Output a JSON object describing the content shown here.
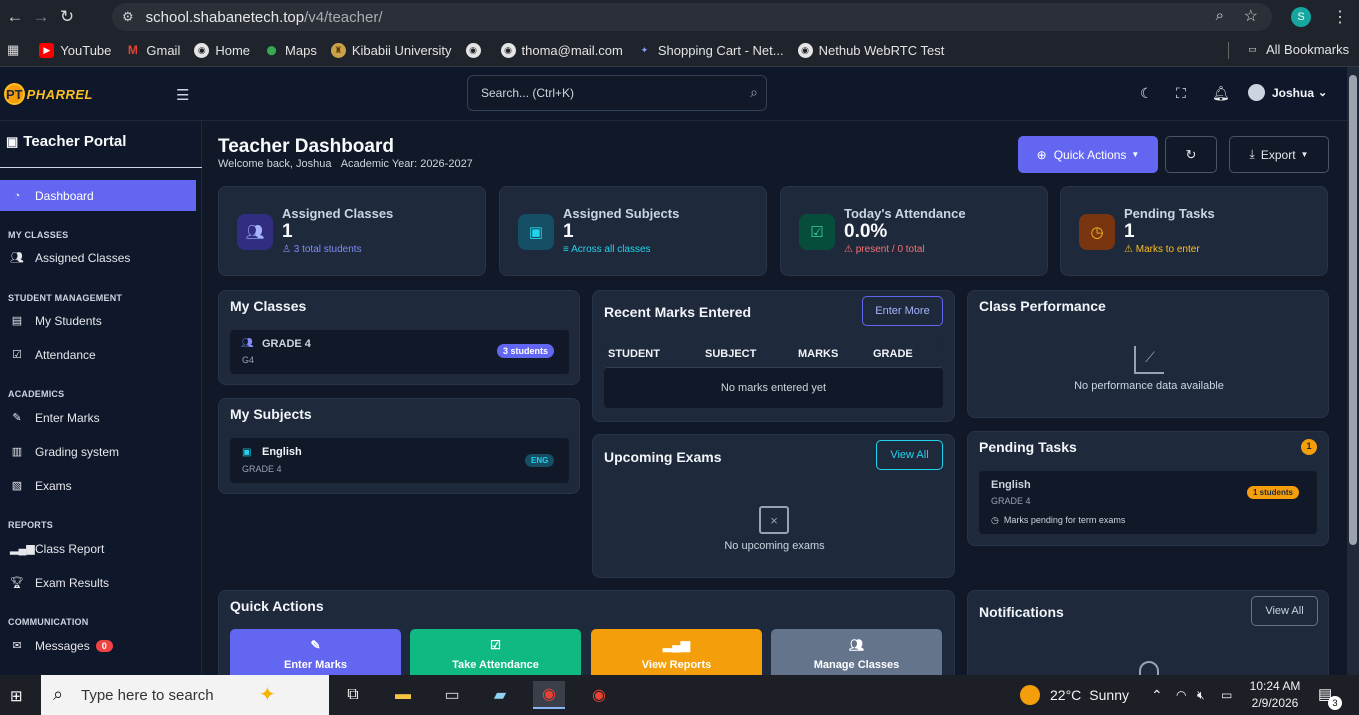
{
  "browser": {
    "url_host": "school.shabanetech.top",
    "url_path": "/v4/teacher/",
    "profile_initial": "S",
    "bookmarks": [
      "YouTube",
      "Gmail",
      "Home",
      "Maps",
      "Kibabii University",
      "",
      "thoma@mail.com",
      "Shopping Cart - Net...",
      "Nethub WebRTC Test"
    ],
    "all_bookmarks": "All Bookmarks"
  },
  "topbar": {
    "logo_text": "PHARREL",
    "logo_initial": "PT",
    "search_placeholder": "Search... (Ctrl+K)",
    "user_name": "Joshua"
  },
  "sidebar": {
    "title": "Teacher Portal",
    "dashboard": "Dashboard",
    "sec_classes": "MY CLASSES",
    "assigned_classes": "Assigned Classes",
    "sec_students": "STUDENT MANAGEMENT",
    "my_students": "My Students",
    "attendance": "Attendance",
    "sec_academics": "ACADEMICS",
    "enter_marks": "Enter Marks",
    "grading_system": "Grading system",
    "exams": "Exams",
    "sec_reports": "REPORTS",
    "class_report": "Class Report",
    "exam_results": "Exam Results",
    "sec_comm": "COMMUNICATION",
    "messages": "Messages",
    "messages_count": "0"
  },
  "header": {
    "title": "Teacher Dashboard",
    "welcome": "Welcome back, Joshua",
    "academic_year": "Academic Year: 2026-2027",
    "quick_actions": "Quick Actions",
    "export": "Export"
  },
  "stats": [
    {
      "label": "Assigned Classes",
      "value": "1",
      "note": "3 total students"
    },
    {
      "label": "Assigned Subjects",
      "value": "1",
      "note": "Across all classes"
    },
    {
      "label": "Today's Attendance",
      "value": "0.0%",
      "note": "present / 0 total"
    },
    {
      "label": "Pending Tasks",
      "value": "1",
      "note": "Marks to enter"
    }
  ],
  "my_classes": {
    "title": "My Classes",
    "class_name": "GRADE 4",
    "class_code": "G4",
    "badge": "3 students"
  },
  "my_subjects": {
    "title": "My Subjects",
    "subject": "English",
    "grade": "GRADE 4",
    "code": "ENG"
  },
  "recent_marks": {
    "title": "Recent Marks Entered",
    "button": "Enter More",
    "columns": [
      "STUDENT",
      "SUBJECT",
      "MARKS",
      "GRADE"
    ],
    "empty": "No marks entered yet"
  },
  "upcoming_exams": {
    "title": "Upcoming Exams",
    "button": "View All",
    "empty": "No upcoming exams"
  },
  "class_performance": {
    "title": "Class Performance",
    "empty": "No performance data available"
  },
  "pending_tasks": {
    "title": "Pending Tasks",
    "count": "1",
    "subject": "English",
    "grade": "GRADE 4",
    "badge": "1 students",
    "note": "Marks pending for term exams"
  },
  "quick_actions": {
    "title": "Quick Actions",
    "buttons": [
      "Enter Marks",
      "Take Attendance",
      "View Reports",
      "Manage Classes"
    ]
  },
  "notifications": {
    "title": "Notifications",
    "button": "View All"
  },
  "colors": {
    "accent": "#6366f1",
    "green": "#10b981",
    "orange": "#f59e0b",
    "slate": "#64748b",
    "cyan": "#22d3ee",
    "red": "#ef4444"
  },
  "taskbar": {
    "search_placeholder": "Type here to search",
    "weather_temp": "22°C",
    "weather_text": "Sunny",
    "time": "10:24 AM",
    "date": "2/9/2026",
    "notif_count": "3"
  }
}
